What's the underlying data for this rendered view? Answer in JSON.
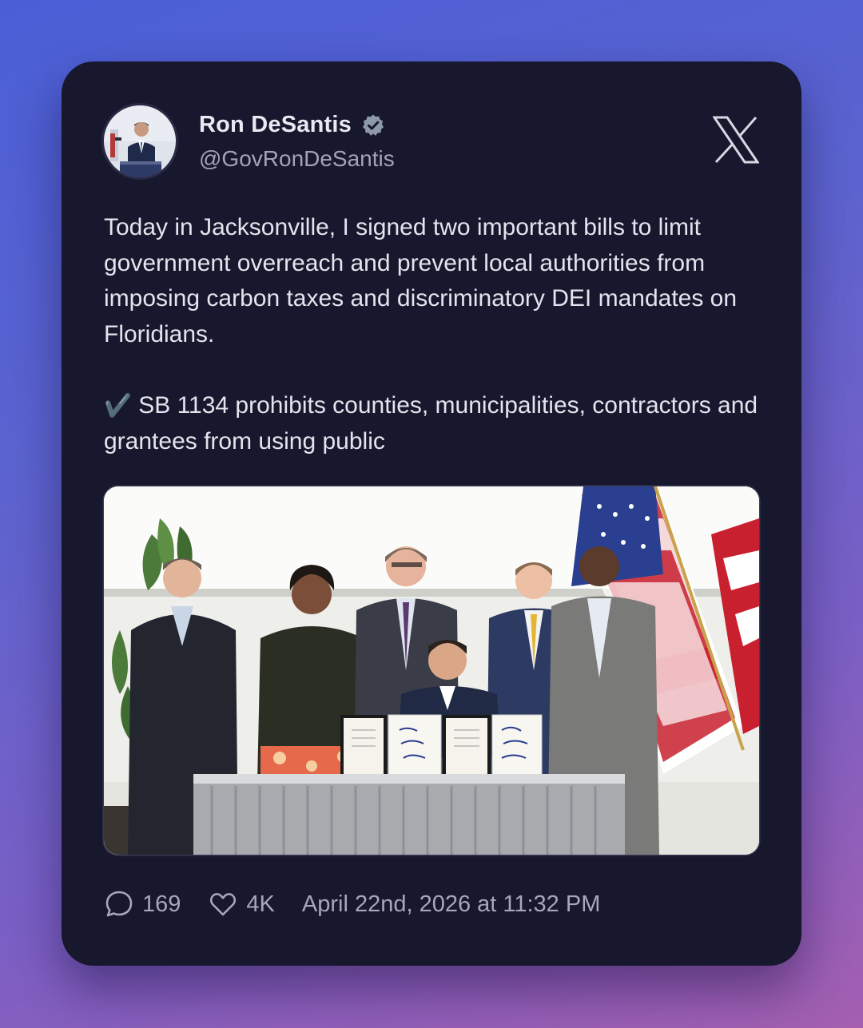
{
  "author": {
    "name": "Ron DeSantis",
    "handle": "@GovRonDeSantis",
    "verified": true,
    "avatar_icon": "profile-photo"
  },
  "platform_icon": "x-logo-icon",
  "tweet": {
    "paragraph_1": "Today in Jacksonville, I signed two important bills to limit government overreach and prevent local authorities from imposing carbon taxes and discriminatory DEI mandates on Floridians.",
    "check_glyph": "✔️",
    "paragraph_2": "SB 1134 prohibits counties, municipalities, contractors and grantees from using public"
  },
  "media": {
    "type": "photo",
    "description_icon": "bill-signing-photo"
  },
  "stats": {
    "replies": "169",
    "likes": "4K",
    "timestamp": "April 22nd, 2026 at 11:32 PM"
  },
  "colors": {
    "card_background": "#17172d",
    "text_primary": "#e4e4ee",
    "text_secondary": "#a6a6bc",
    "verified_badge": "#8e99a8"
  }
}
